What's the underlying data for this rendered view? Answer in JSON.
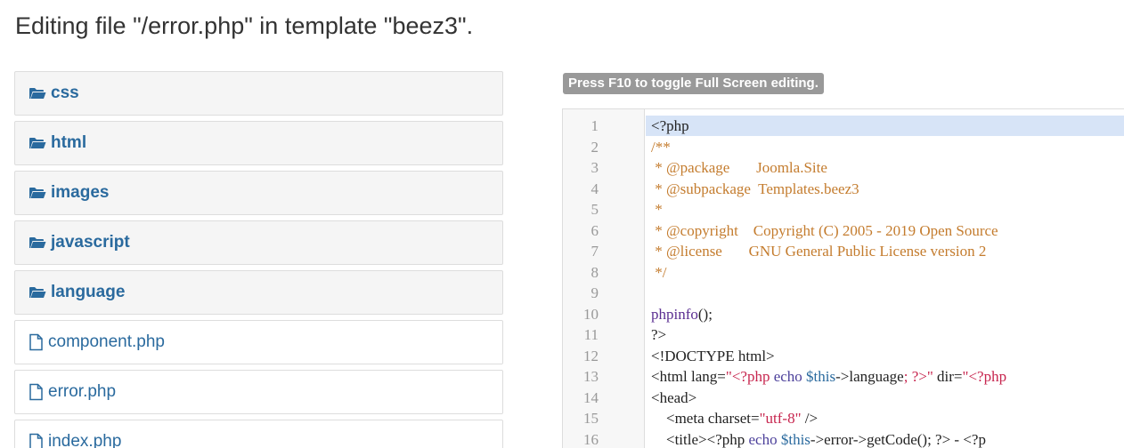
{
  "page": {
    "title": "Editing file \"/error.php\" in template \"beez3\"."
  },
  "tree": {
    "items": [
      {
        "type": "folder",
        "label": "css",
        "icon": "folder-open-icon"
      },
      {
        "type": "folder",
        "label": "html",
        "icon": "folder-open-icon"
      },
      {
        "type": "folder",
        "label": "images",
        "icon": "folder-open-icon"
      },
      {
        "type": "folder",
        "label": "javascript",
        "icon": "folder-open-icon"
      },
      {
        "type": "folder",
        "label": "language",
        "icon": "folder-open-icon"
      },
      {
        "type": "file",
        "label": "component.php",
        "icon": "file-icon"
      },
      {
        "type": "file",
        "label": "error.php",
        "icon": "file-icon"
      },
      {
        "type": "file",
        "label": "index.php",
        "icon": "file-icon"
      }
    ]
  },
  "editor": {
    "hint": "Press F10 to toggle Full Screen editing.",
    "active_line": 1,
    "lines": [
      {
        "n": "1",
        "tokens": [
          {
            "t": "<?php",
            "c": "tag"
          }
        ]
      },
      {
        "n": "2",
        "tokens": [
          {
            "t": "/**",
            "c": "comment"
          }
        ]
      },
      {
        "n": "3",
        "tokens": [
          {
            "t": " * @package       Joomla.Site",
            "c": "comment"
          }
        ]
      },
      {
        "n": "4",
        "tokens": [
          {
            "t": " * @subpackage  Templates.beez3",
            "c": "comment"
          }
        ]
      },
      {
        "n": "5",
        "tokens": [
          {
            "t": " *",
            "c": "comment"
          }
        ]
      },
      {
        "n": "6",
        "tokens": [
          {
            "t": " * @copyright    Copyright (C) 2005 - 2019 Open Source",
            "c": "comment"
          }
        ]
      },
      {
        "n": "7",
        "tokens": [
          {
            "t": " * @license       GNU General Public License version 2",
            "c": "comment"
          }
        ]
      },
      {
        "n": "8",
        "tokens": [
          {
            "t": " */",
            "c": "comment"
          }
        ]
      },
      {
        "n": "9",
        "tokens": []
      },
      {
        "n": "10",
        "tokens": [
          {
            "t": "phpinfo",
            "c": "func"
          },
          {
            "t": "();",
            "c": "tag"
          }
        ]
      },
      {
        "n": "11",
        "tokens": [
          {
            "t": "?>",
            "c": "tag"
          }
        ]
      },
      {
        "n": "12",
        "tokens": [
          {
            "t": "<!DOCTYPE html>",
            "c": "tag"
          }
        ]
      },
      {
        "n": "13",
        "tokens": [
          {
            "t": "<html lang=",
            "c": "tag"
          },
          {
            "t": "\"<?php ",
            "c": "str"
          },
          {
            "t": "echo ",
            "c": "kw"
          },
          {
            "t": "$this",
            "c": "var"
          },
          {
            "t": "->language",
            "c": "tag"
          },
          {
            "t": "; ?>\"",
            "c": "str"
          },
          {
            "t": " dir=",
            "c": "tag"
          },
          {
            "t": "\"<?php",
            "c": "str"
          }
        ]
      },
      {
        "n": "14",
        "tokens": [
          {
            "t": "<head>",
            "c": "tag"
          }
        ]
      },
      {
        "n": "15",
        "tokens": [
          {
            "t": "    <meta charset=",
            "c": "tag"
          },
          {
            "t": "\"utf-8\"",
            "c": "str"
          },
          {
            "t": " />",
            "c": "tag"
          }
        ]
      },
      {
        "n": "16",
        "tokens": [
          {
            "t": "    <title><?php ",
            "c": "tag"
          },
          {
            "t": "echo ",
            "c": "kw"
          },
          {
            "t": "$this",
            "c": "var"
          },
          {
            "t": "->error->getCode(); ?> - <?p",
            "c": "tag"
          }
        ]
      }
    ]
  },
  "colors": {
    "link": "#2a6a9e",
    "comment": "#c47c2e",
    "active_line": "#d7e4f7",
    "hint_bg": "#999999"
  }
}
